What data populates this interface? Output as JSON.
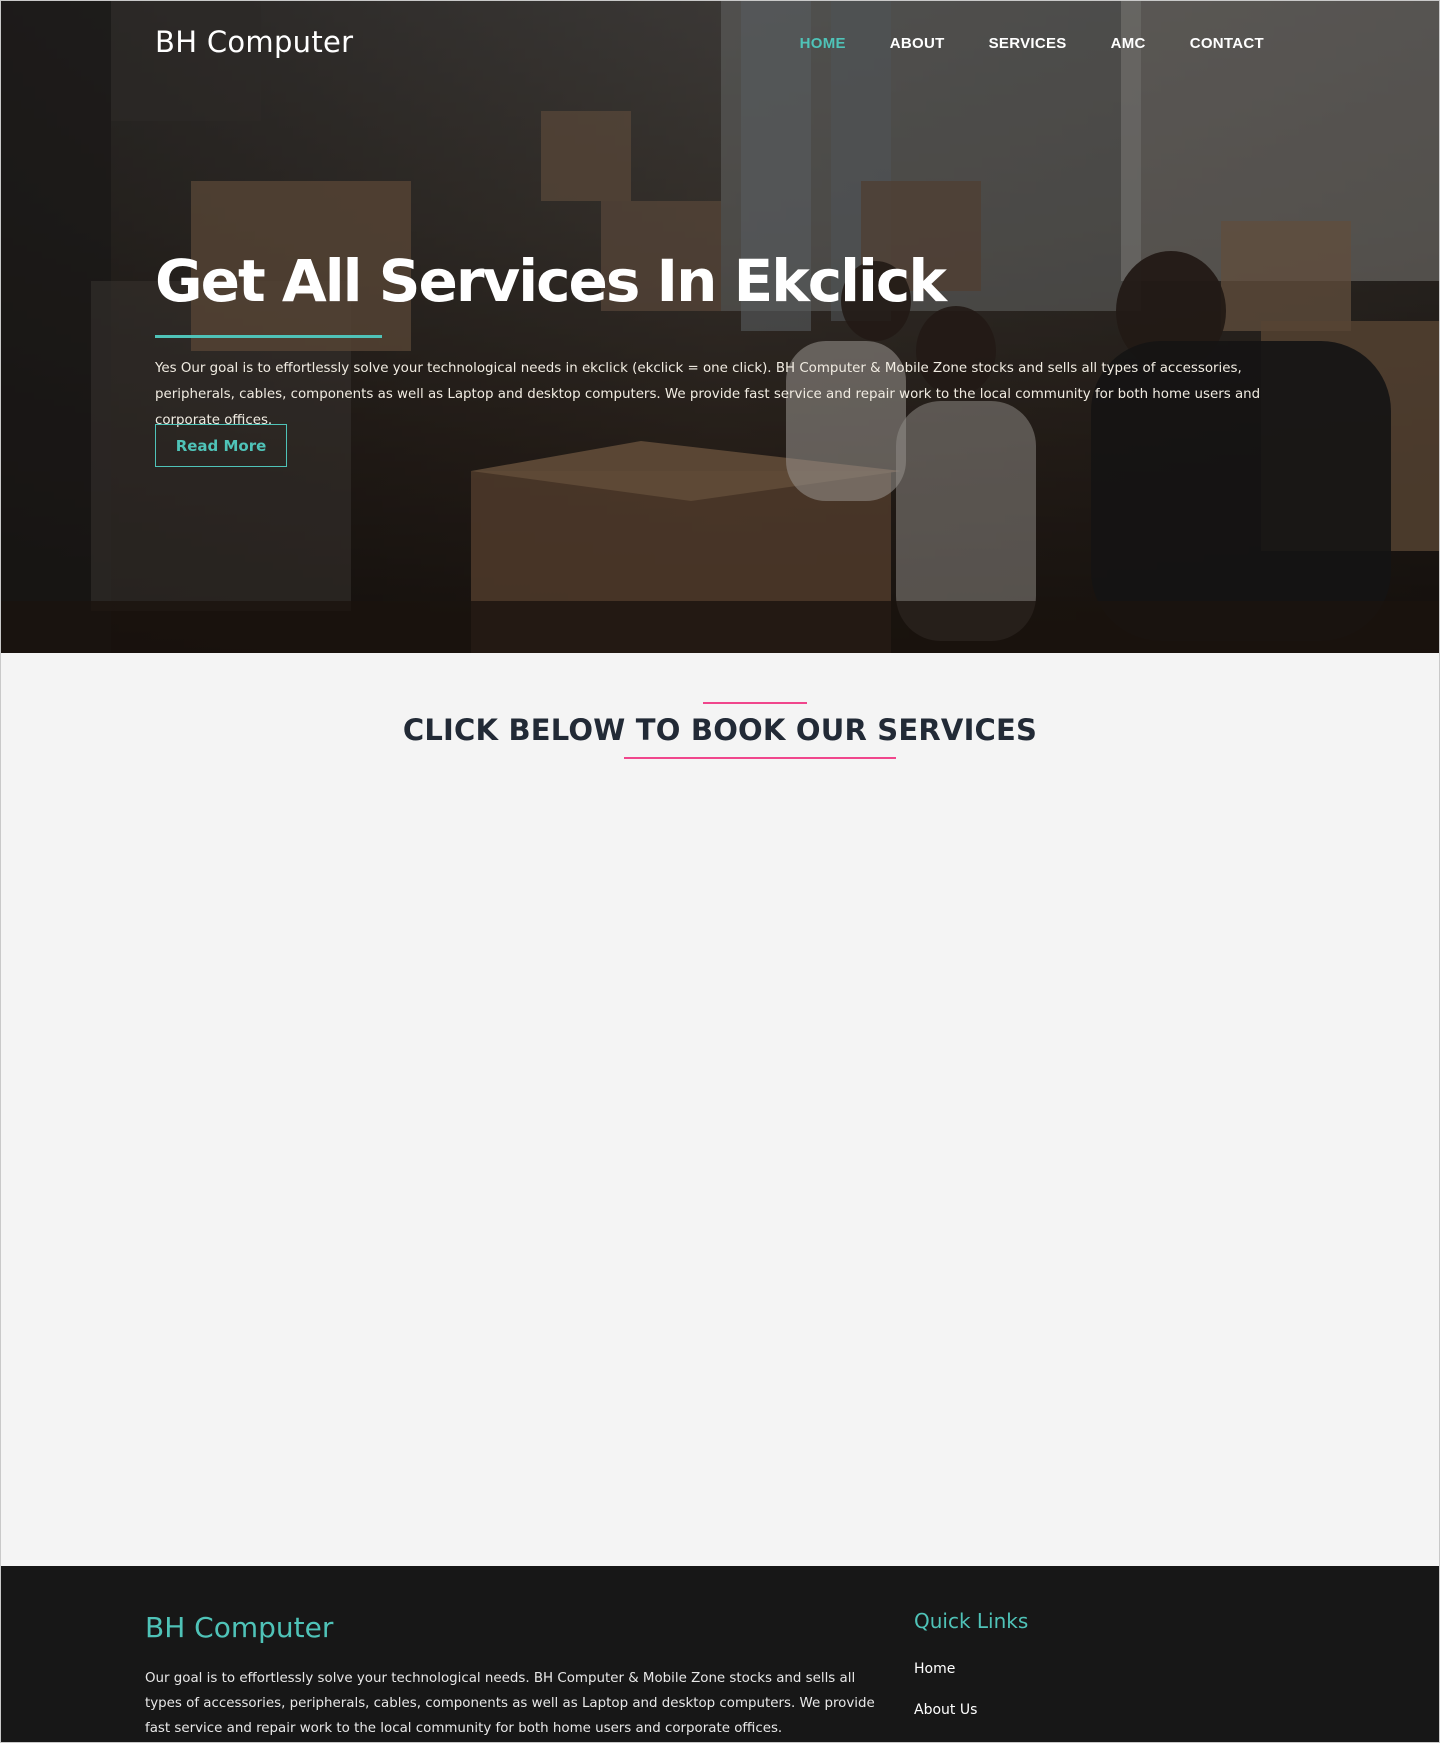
{
  "header": {
    "brand": "BH Computer",
    "nav": [
      {
        "label": "HOME",
        "active": true
      },
      {
        "label": "ABOUT",
        "active": false
      },
      {
        "label": "SERVICES",
        "active": false
      },
      {
        "label": "AMC",
        "active": false
      },
      {
        "label": "CONTACT",
        "active": false
      }
    ]
  },
  "hero": {
    "title": "Get All Services In Ekclick",
    "text": "Yes Our goal is to effortlessly solve your technological needs in ekclick (ekclick = one click). BH Computer & Mobile Zone stocks and sells all types of accessories, peripherals, cables, components as well as Laptop and desktop computers. We provide fast service and repair work to the local community for both home users and corporate offices.",
    "button": "Read More"
  },
  "services": {
    "heading": "CLICK BELOW TO BOOK OUR SERVICES"
  },
  "footer": {
    "brand": "BH Computer",
    "text": "Our goal is to effortlessly solve your technological needs. BH Computer & Mobile Zone stocks and sells all types of accessories, peripherals, cables, components as well as Laptop and desktop computers. We provide fast service and repair work to the local community for both home users and corporate offices.",
    "quick_links_title": "Quick Links",
    "quick_links": [
      "Home",
      "About Us"
    ]
  },
  "colors": {
    "accent": "#4fc3b8",
    "pink": "#f0468c",
    "heading": "#222a36",
    "footer_bg": "#171717"
  }
}
